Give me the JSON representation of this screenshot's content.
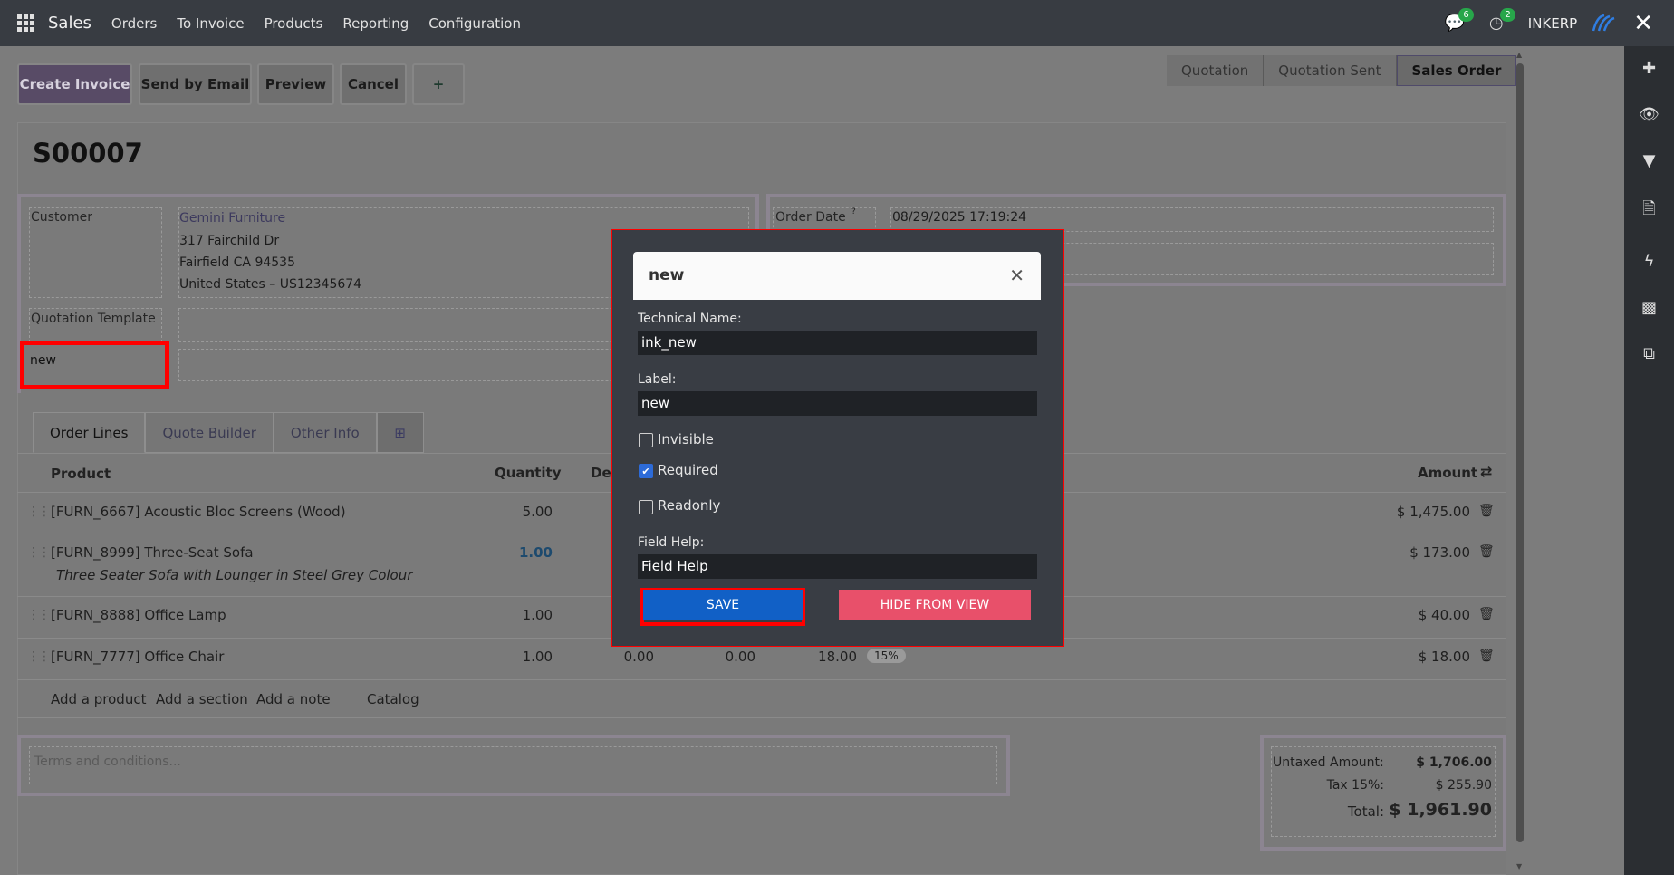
{
  "topbar": {
    "app": "Sales",
    "menu": [
      "Orders",
      "To Invoice",
      "Products",
      "Reporting",
      "Configuration"
    ],
    "chat_count": "6",
    "activity_count": "2",
    "company": "INKERP"
  },
  "actions": {
    "create_invoice": "Create Invoice",
    "send_email": "Send by Email",
    "preview": "Preview",
    "cancel": "Cancel",
    "add": "+"
  },
  "status": [
    "Quotation",
    "Quotation Sent",
    "Sales Order"
  ],
  "record": {
    "name": "S00007",
    "customer_label": "Customer",
    "customer_name": "Gemini Furniture",
    "address1": "317 Fairchild Dr",
    "address2": "Fairfield CA 94535",
    "address3": "United States – US12345674",
    "template_label": "Quotation Template",
    "new_label": "new",
    "order_date_label": "Order Date",
    "order_date_help": "?",
    "order_date": "08/29/2025 17:19:24"
  },
  "tabs": [
    "Order Lines",
    "Quote Builder",
    "Other Info"
  ],
  "columns": {
    "product": "Product",
    "quantity": "Quantity",
    "delivered": "Del",
    "amount": "Amount"
  },
  "lines": [
    {
      "product": "[FURN_6667] Acoustic Bloc Screens (Wood)",
      "qty": "5.00",
      "amount": "$ 1,475.00"
    },
    {
      "product": "[FURN_8999] Three-Seat Sofa",
      "desc": "Three Seater Sofa with Lounger in Steel Grey Colour",
      "qty": "1.00",
      "amount": "$ 173.00"
    },
    {
      "product": "[FURN_8888] Office Lamp",
      "qty": "1.00",
      "amount": "$ 40.00"
    },
    {
      "product": "[FURN_7777] Office Chair",
      "qty": "1.00",
      "delivered": "0.00",
      "invoiced": "0.00",
      "price": "18.00",
      "tax": "15%",
      "amount": "$ 18.00"
    }
  ],
  "add_links": [
    "Add a product",
    "Add a section",
    "Add a note",
    "Catalog"
  ],
  "terms_placeholder": "Terms and conditions...",
  "totals": {
    "untaxed_label": "Untaxed Amount:",
    "untaxed": "$ 1,706.00",
    "tax_label": "Tax 15%:",
    "tax": "$ 255.90",
    "total_label": "Total:",
    "total": "$ 1,961.90"
  },
  "modal": {
    "title": "new",
    "tech_label": "Technical Name:",
    "tech_value": "ink_new",
    "label_label": "Label:",
    "label_value": "new",
    "invisible": "Invisible",
    "required": "Required",
    "readonly": "Readonly",
    "help_label": "Field Help:",
    "help_value": "Field Help",
    "save": "SAVE",
    "hide": "HIDE FROM VIEW"
  },
  "colors": {
    "accent": "#584b66",
    "highlight": "#ff0000",
    "save": "#1160c6",
    "hide": "#e8506a"
  }
}
